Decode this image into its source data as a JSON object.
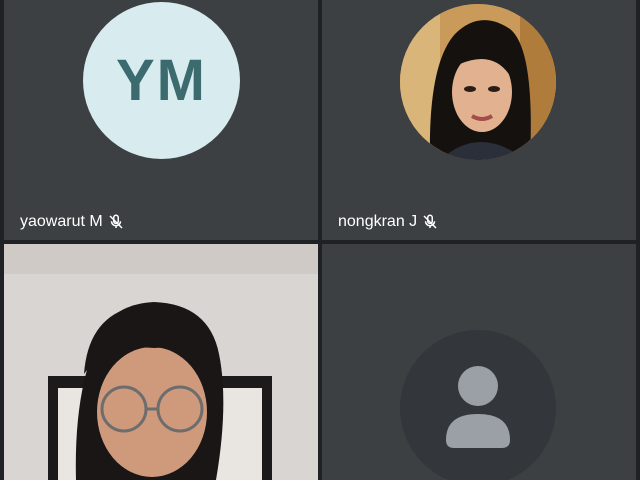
{
  "participants": [
    {
      "name": "yaowarut M",
      "initials": "YM",
      "avatar_bg": "#d8ecef",
      "initials_color": "#3b6b6e",
      "mic": "muted",
      "icon": "mic-off-icon"
    },
    {
      "name": "nongkran J",
      "avatar": "profile-photo",
      "mic": "muted",
      "icon": "mic-off-icon"
    },
    {
      "name": "",
      "video": "camera-feed"
    },
    {
      "name": "",
      "avatar": "default-person-icon"
    }
  ],
  "colors": {
    "background": "#202124",
    "tile": "#3c4043",
    "text": "#ffffff"
  }
}
